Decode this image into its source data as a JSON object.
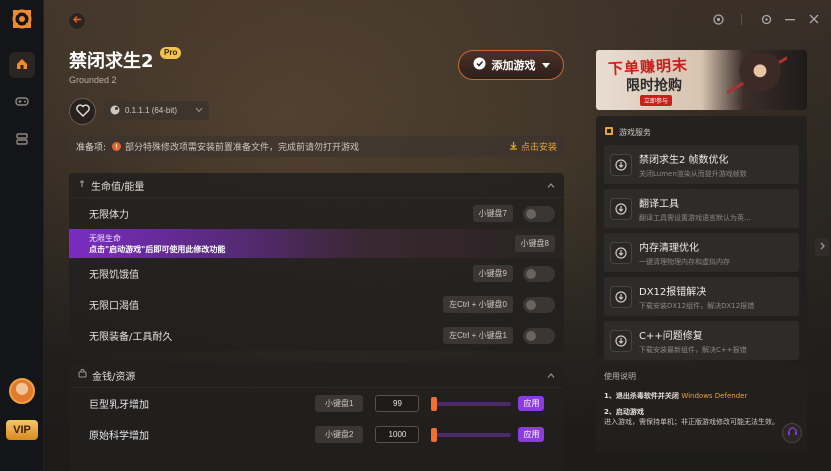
{
  "sidebar": {
    "logo_icon": "app-logo-icon",
    "items": [
      {
        "icon": "home-icon",
        "active": true
      },
      {
        "icon": "gamepad-icon",
        "active": false
      },
      {
        "icon": "layers-icon",
        "active": false
      }
    ],
    "vip_label": "VIP"
  },
  "header": {
    "title": "禁闭求生2",
    "pro_badge": "Pro",
    "subtitle": "Grounded 2",
    "version": "0.1.1.1 (64-bit)",
    "add_game_label": "添加游戏"
  },
  "notice": {
    "label": "准备项:",
    "text": "部分特殊修改项需安装前置准备文件，完成前请勿打开游戏",
    "install_label": "点击安装"
  },
  "health_panel": {
    "title": "生命值/能量",
    "rows": [
      {
        "name": "无限体力",
        "key": "小键盘7"
      },
      {
        "name_line1": "无限生命",
        "name_line2": "点击\"启动游戏\"后即可使用此修改功能",
        "key": "小键盘8"
      },
      {
        "name": "无限饥饿值",
        "key": "小键盘9"
      },
      {
        "name": "无限口渴值",
        "key": "左Ctrl + 小键盘0"
      },
      {
        "name": "无限装备/工具耐久",
        "key": "左Ctrl + 小键盘1"
      }
    ]
  },
  "money_panel": {
    "title": "金钱/资源",
    "rows": [
      {
        "name": "巨型乳牙增加",
        "key": "小键盘1",
        "value": "99",
        "slider_fraction": 0.0,
        "apply": "应用"
      },
      {
        "name": "原始科学增加",
        "key": "小键盘2",
        "value": "1000",
        "slider_fraction": 0.0,
        "apply": "应用"
      }
    ]
  },
  "banner": {
    "title": "下单赚明末",
    "subtitle": "限时抢购",
    "tag": "立即参与"
  },
  "services": {
    "title": "游戏服务",
    "items": [
      {
        "title": "禁闭求生2 帧数优化",
        "desc": "关闭Lumen渲染从而提升游戏帧数"
      },
      {
        "title": "翻译工具",
        "desc": "翻译工具需设置游戏语言默认为英..."
      },
      {
        "title": "内存清理优化",
        "desc": "一键清理物理内存和虚拟内存"
      },
      {
        "title": "DX12报错解决",
        "desc": "下载安装DX12组件，解决DX12报错"
      },
      {
        "title": "C++问题修复",
        "desc": "下载安装最新组件，解决C++报错"
      }
    ]
  },
  "usage": {
    "title": "使用说明",
    "step1_prefix": "1、退出杀毒软件并关闭",
    "step1_highlight": "Windows Defender",
    "step2_title": "2、启动游戏",
    "step2_text": "进入游戏，需保持单机；非正版游戏修改可能无法生效。"
  },
  "colors": {
    "accent": "#e2662b",
    "purple": "#8a3ce0",
    "gold": "#f3c14d",
    "background": "#17181b"
  }
}
